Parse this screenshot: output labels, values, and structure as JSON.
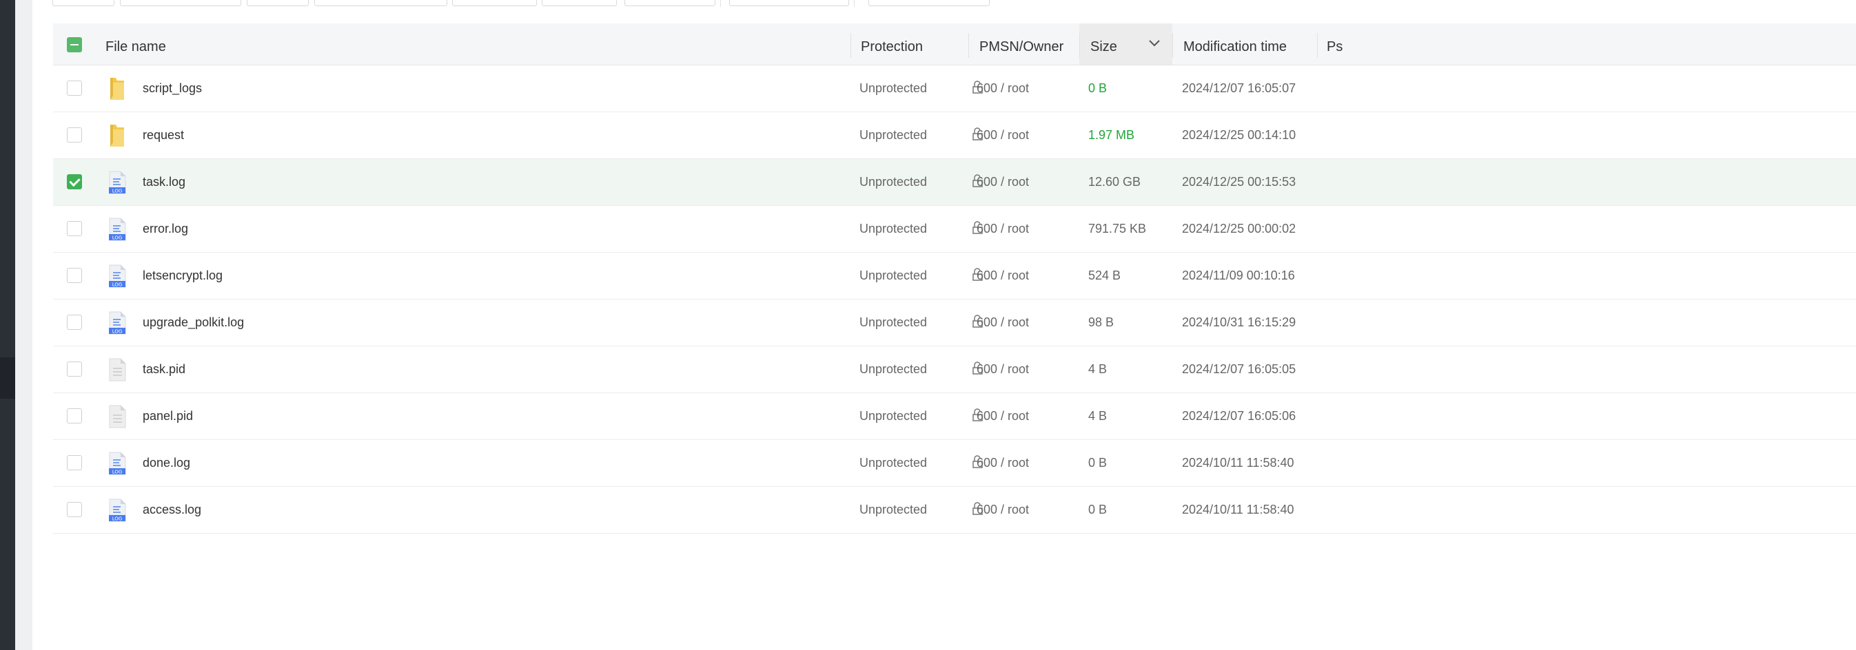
{
  "header": {
    "file_name": "File name",
    "protection": "Protection",
    "pmsn_owner": "PMSN/Owner",
    "size": "Size",
    "modification_time": "Modification time",
    "ps": "Ps"
  },
  "colors": {
    "accent": "#20a53a",
    "sidebar": "#2b2f36"
  },
  "rows": [
    {
      "name": "script_logs",
      "type": "folder",
      "protection": "Unprotected",
      "perm": "600 / root",
      "size": "0 B",
      "size_color": "green",
      "mtime": "2024/12/07 16:05:07",
      "checked": false
    },
    {
      "name": "request",
      "type": "folder",
      "protection": "Unprotected",
      "perm": "600 / root",
      "size": "1.97 MB",
      "size_color": "green",
      "mtime": "2024/12/25 00:14:10",
      "checked": false
    },
    {
      "name": "task.log",
      "type": "log",
      "protection": "Unprotected",
      "perm": "600 / root",
      "size": "12.60 GB",
      "size_color": "normal",
      "mtime": "2024/12/25 00:15:53",
      "checked": true
    },
    {
      "name": "error.log",
      "type": "log",
      "protection": "Unprotected",
      "perm": "600 / root",
      "size": "791.75 KB",
      "size_color": "normal",
      "mtime": "2024/12/25 00:00:02",
      "checked": false
    },
    {
      "name": "letsencrypt.log",
      "type": "log",
      "protection": "Unprotected",
      "perm": "600 / root",
      "size": "524 B",
      "size_color": "normal",
      "mtime": "2024/11/09 00:10:16",
      "checked": false
    },
    {
      "name": "upgrade_polkit.log",
      "type": "log",
      "protection": "Unprotected",
      "perm": "600 / root",
      "size": "98 B",
      "size_color": "normal",
      "mtime": "2024/10/31 16:15:29",
      "checked": false
    },
    {
      "name": "task.pid",
      "type": "text",
      "protection": "Unprotected",
      "perm": "600 / root",
      "size": "4 B",
      "size_color": "normal",
      "mtime": "2024/12/07 16:05:05",
      "checked": false
    },
    {
      "name": "panel.pid",
      "type": "text",
      "protection": "Unprotected",
      "perm": "600 / root",
      "size": "4 B",
      "size_color": "normal",
      "mtime": "2024/12/07 16:05:06",
      "checked": false
    },
    {
      "name": "done.log",
      "type": "log",
      "protection": "Unprotected",
      "perm": "600 / root",
      "size": "0 B",
      "size_color": "normal",
      "mtime": "2024/10/11 11:58:40",
      "checked": false
    },
    {
      "name": "access.log",
      "type": "log",
      "protection": "Unprotected",
      "perm": "600 / root",
      "size": "0 B",
      "size_color": "normal",
      "mtime": "2024/10/11 11:58:40",
      "checked": false
    }
  ]
}
